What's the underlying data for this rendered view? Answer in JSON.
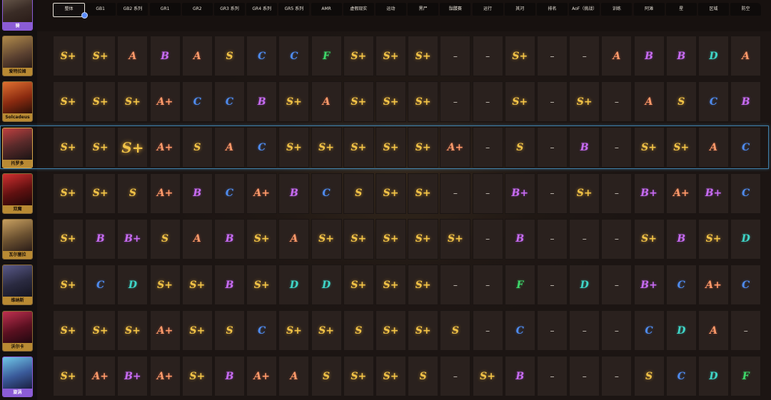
{
  "columns": [
    "整体",
    "GB1",
    "GB2 系列",
    "GR1",
    "GR2",
    "GR3 系列",
    "GR4 系列",
    "GR5 系列",
    "AMR",
    "虚假现实",
    "运动",
    "黑尸",
    "骷髅赛",
    "运行",
    "其河",
    "排名",
    "AoF（挑战）",
    "训练",
    "阿滩",
    "星",
    "区域",
    "防空"
  ],
  "active_column": 0,
  "colors": {
    "S": "#f2c447",
    "A": "#ff9a6a",
    "B": "#c86bf2",
    "C": "#4f8cf0",
    "D": "#3fd6c8",
    "F": "#3ed86a",
    "hero_border_gold": "#8a6a35",
    "hero_border_purple": "#8b5cd6",
    "selected_row_border": "#3f7fa8"
  },
  "heroes": [
    {
      "name": "骑",
      "frame": "purple",
      "icon": "warrior-portrait-icon"
    },
    {
      "name": "爱特拉姆",
      "frame": "gold",
      "icon": "golem-portrait-icon"
    },
    {
      "name": "Solcadeus",
      "frame": "gold",
      "icon": "fire-demon-portrait-icon"
    },
    {
      "name": "托罗多",
      "frame": "gold",
      "icon": "armored-knight-portrait-icon"
    },
    {
      "name": "双魔",
      "frame": "gold",
      "icon": "red-demon-portrait-icon"
    },
    {
      "name": "瓦尔塞拉",
      "frame": "gold",
      "icon": "valkyrie-portrait-icon"
    },
    {
      "name": "维纳斯",
      "frame": "gold",
      "icon": "dark-sorceress-portrait-icon"
    },
    {
      "name": "沃尔卡",
      "frame": "gold",
      "icon": "crimson-witch-portrait-icon"
    },
    {
      "name": "旋涡",
      "frame": "purple",
      "icon": "ice-dragon-portrait-icon"
    }
  ],
  "selected_row": 2,
  "grades": [
    [
      "S+",
      "S+",
      "A",
      "B",
      "A",
      "S",
      "C",
      "C",
      "F",
      "S+",
      "S+",
      "S+",
      "-",
      "-",
      "S+",
      "-",
      "-",
      "A",
      "B",
      "B",
      "D",
      "A"
    ],
    [
      "S+",
      "S+",
      "S+",
      "A+",
      "C",
      "C",
      "B",
      "S+",
      "A",
      "S+",
      "S+",
      "S+",
      "-",
      "-",
      "S+",
      "-",
      "S+",
      "-",
      "A",
      "S",
      "C",
      "B"
    ],
    [
      "S+",
      "S+",
      "S+",
      "A+",
      "S",
      "A",
      "C",
      "S+",
      "S+",
      "S+",
      "S+",
      "S+",
      "A+",
      "-",
      "S",
      "-",
      "B",
      "-",
      "S+",
      "S+",
      "A",
      "C"
    ],
    [
      "S+",
      "S+",
      "S",
      "A+",
      "B",
      "C",
      "A+",
      "B",
      "C",
      "S",
      "S+",
      "S+",
      "-",
      "-",
      "B+",
      "-",
      "S+",
      "-",
      "B+",
      "A+",
      "B+",
      "C"
    ],
    [
      "S+",
      "B",
      "B+",
      "S",
      "A",
      "B",
      "S+",
      "A",
      "S+",
      "S+",
      "S+",
      "S+",
      "S+",
      "-",
      "B",
      "-",
      "-",
      "-",
      "S+",
      "B",
      "S+",
      "D"
    ],
    [
      "S+",
      "C",
      "D",
      "S+",
      "S+",
      "B",
      "S+",
      "D",
      "D",
      "S+",
      "S+",
      "S+",
      "-",
      "-",
      "F",
      "-",
      "D",
      "-",
      "B+",
      "C",
      "A+",
      "C"
    ],
    [
      "S+",
      "S+",
      "S+",
      "A+",
      "S+",
      "S",
      "C",
      "S+",
      "S+",
      "S",
      "S+",
      "S+",
      "S",
      "-",
      "C",
      "-",
      "-",
      "-",
      "C",
      "D",
      "A",
      "-"
    ],
    [
      "S+",
      "A+",
      "B+",
      "A+",
      "S+",
      "B",
      "A+",
      "A",
      "S",
      "S+",
      "S+",
      "S",
      "-",
      "S+",
      "B",
      "-",
      "-",
      "-",
      "S",
      "C",
      "D",
      "F"
    ]
  ]
}
